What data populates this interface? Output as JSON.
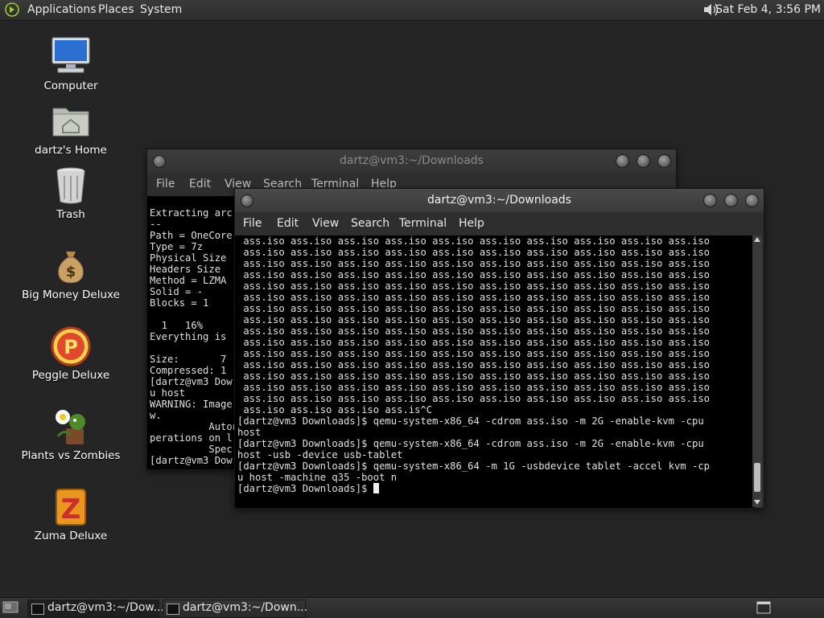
{
  "top_panel": {
    "menus": [
      "Applications",
      "Places",
      "System"
    ],
    "clock": "Sat Feb  4,  3:56 PM"
  },
  "desktop_icons": [
    {
      "label": "Computer",
      "icon": "computer-icon"
    },
    {
      "label": "dartz's Home",
      "icon": "home-folder-icon"
    },
    {
      "label": "Trash",
      "icon": "trash-icon"
    },
    {
      "label": "Big Money Deluxe",
      "icon": "money-bag-icon"
    },
    {
      "label": "Peggle Deluxe",
      "icon": "peggle-icon"
    },
    {
      "label": "Plants vs Zombies",
      "icon": "plants-vs-zombies-icon"
    },
    {
      "label": "Zuma Deluxe",
      "icon": "zuma-icon"
    }
  ],
  "back_window": {
    "title": "dartz@vm3:~/Downloads",
    "menu": [
      "File",
      "Edit",
      "View",
      "Search",
      "Terminal",
      "Help"
    ],
    "lines": [
      "",
      "Extracting arc",
      "--",
      "Path = OneCore",
      "Type = 7z",
      "Physical Size",
      "Headers Size",
      "Method = LZMA",
      "Solid = -",
      "Blocks = 1",
      "",
      "  1   16%",
      "Everything is",
      "",
      "Size:       7",
      "Compressed: 1",
      "[dartz@vm3 Dow",
      "u host",
      "WARNING: Image",
      "w.",
      "          Auton",
      "perations on l",
      "          Spec",
      "[dartz@vm3 Dow"
    ]
  },
  "front_window": {
    "title": "dartz@vm3:~/Downloads",
    "menu": [
      "File",
      "Edit",
      "View",
      "Search",
      "Terminal",
      "Help"
    ],
    "iso_row": " ass.iso ass.iso ass.iso ass.iso ass.iso ass.iso ass.iso ass.iso ass.iso ass.iso",
    "iso_row_count": 15,
    "tail_lines": [
      " ass.iso ass.iso ass.iso ass.is^C",
      "[dartz@vm3 Downloads]$ qemu-system-x86_64 -cdrom ass.iso -m 2G -enable-kvm -cpu",
      "host",
      "[dartz@vm3 Downloads]$ qemu-system-x86_64 -cdrom ass.iso -m 2G -enable-kvm -cpu",
      "host -usb -device usb-tablet",
      "[dartz@vm3 Downloads]$ qemu-system-x86_64 -m 1G -usbdevice tablet -accel kvm -cp",
      "u host -machine q35 -boot n"
    ],
    "prompt": "[dartz@vm3 Downloads]$ "
  },
  "taskbar": {
    "tasks": [
      {
        "label": "dartz@vm3:~/Dow..."
      },
      {
        "label": "dartz@vm3:~/Down..."
      }
    ]
  }
}
